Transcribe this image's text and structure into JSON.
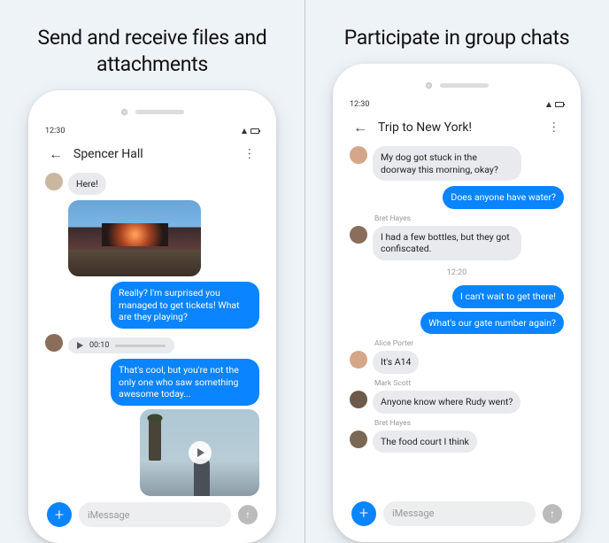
{
  "titles": {
    "left": "Send and receive files and attachments",
    "right": "Participate in group chats"
  },
  "status": {
    "time": "12:30"
  },
  "left": {
    "header": "Spencer Hall",
    "m1": "Here!",
    "m2": "Really? I'm surprised you managed to get tickets! What are they playing?",
    "audioTime": "00:10",
    "m3": "That's cool, but you're not the only one who saw something awesome today..."
  },
  "right": {
    "header": "Trip to New York!",
    "m1": "My dog got stuck in the doorway this morning, okay?",
    "m2": "Does anyone have water?",
    "s3": "Bret Hayes",
    "m3": "I had a few bottles, but they got confiscated.",
    "ts": "12:20",
    "m4": "I can't wait to get there!",
    "m5": "What's our gate number again?",
    "s6": "Alice Porter",
    "m6": "It's A14",
    "s7": "Mark Scott",
    "m7": "Anyone know where Rudy went?",
    "s8": "Bret Hayes",
    "m8": "The food court I think"
  },
  "input": {
    "placeholder": "iMessage"
  }
}
